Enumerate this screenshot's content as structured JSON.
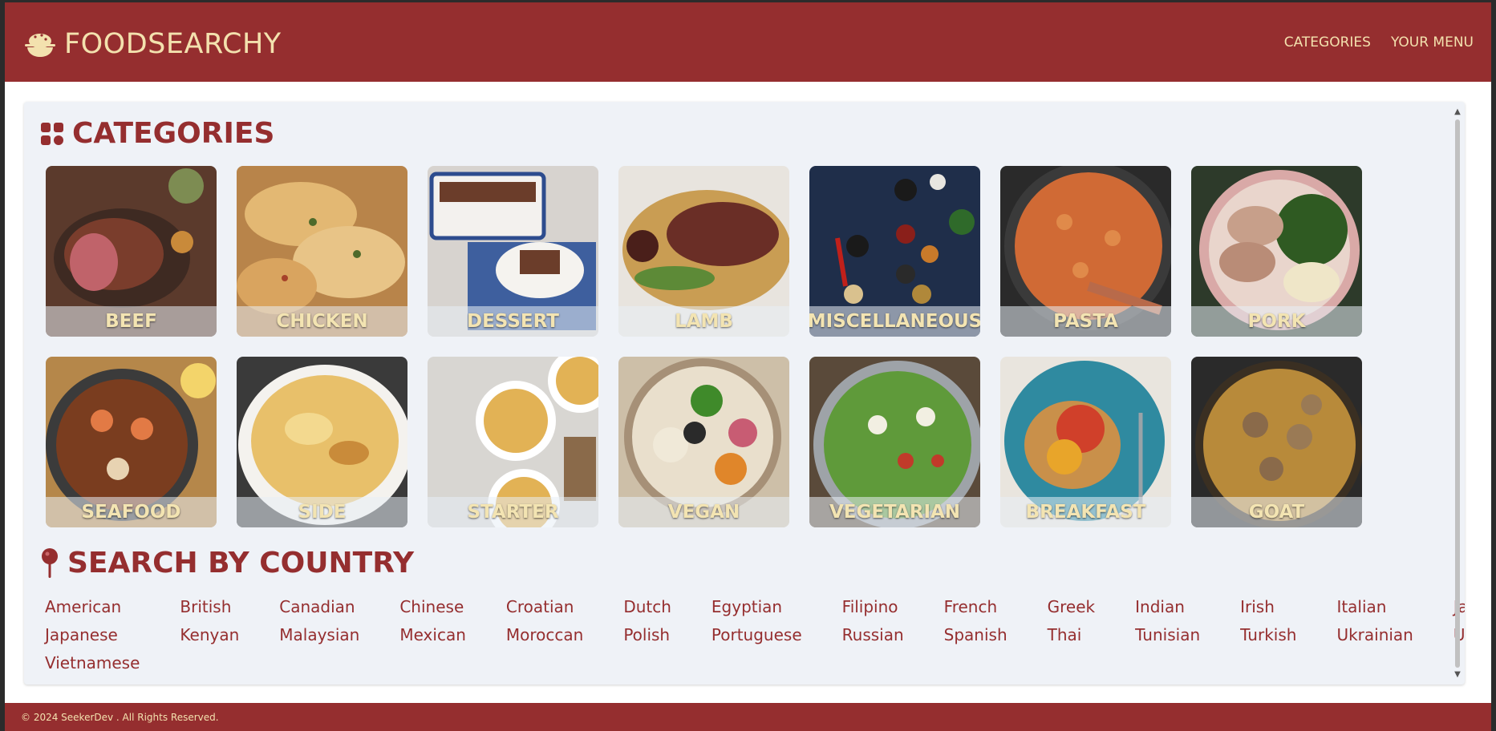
{
  "header": {
    "brand_name": "FOODSEARCHY",
    "brand_icon": "rice-bowl-icon",
    "nav": [
      {
        "label": "CATEGORIES"
      },
      {
        "label": "YOUR MENU"
      }
    ]
  },
  "categories": {
    "title": "CATEGORIES",
    "icon": "grid-icon",
    "items": [
      {
        "label": "BEEF",
        "bg": "#7a3d2c"
      },
      {
        "label": "CHICKEN",
        "bg": "#c98f4d"
      },
      {
        "label": "DESSERT",
        "bg": "#c9c3bb"
      },
      {
        "label": "LAMB",
        "bg": "#8a4a31"
      },
      {
        "label": "MISCELLANEOUS",
        "bg": "#1f2e4a"
      },
      {
        "label": "PASTA",
        "bg": "#c8612e"
      },
      {
        "label": "PORK",
        "bg": "#3f5a2c"
      },
      {
        "label": "SEAFOOD",
        "bg": "#8a4a24"
      },
      {
        "label": "SIDE",
        "bg": "#d9b460"
      },
      {
        "label": "STARTER",
        "bg": "#cdb896"
      },
      {
        "label": "VEGAN",
        "bg": "#a68b5b"
      },
      {
        "label": "VEGETARIAN",
        "bg": "#4f7a33"
      },
      {
        "label": "BREAKFAST",
        "bg": "#2f7b88"
      },
      {
        "label": "GOAT",
        "bg": "#8a6a33"
      }
    ]
  },
  "countries": {
    "title": "SEARCH BY COUNTRY",
    "icon": "map-pin-icon",
    "items": [
      "American",
      "British",
      "Canadian",
      "Chinese",
      "Croatian",
      "Dutch",
      "Egyptian",
      "Filipino",
      "French",
      "Greek",
      "Indian",
      "Irish",
      "Italian",
      "Jamaican",
      "Japanese",
      "Kenyan",
      "Malaysian",
      "Mexican",
      "Moroccan",
      "Polish",
      "Portuguese",
      "Russian",
      "Spanish",
      "Thai",
      "Tunisian",
      "Turkish",
      "Ukrainian",
      "Unknown",
      "Vietnamese"
    ]
  },
  "footer": {
    "text": "© 2024 SeekerDev . All Rights Reserved."
  },
  "colors": {
    "brand": "#952e2f",
    "accent_text": "#f3e1ae",
    "content_bg": "#eff2f7"
  }
}
